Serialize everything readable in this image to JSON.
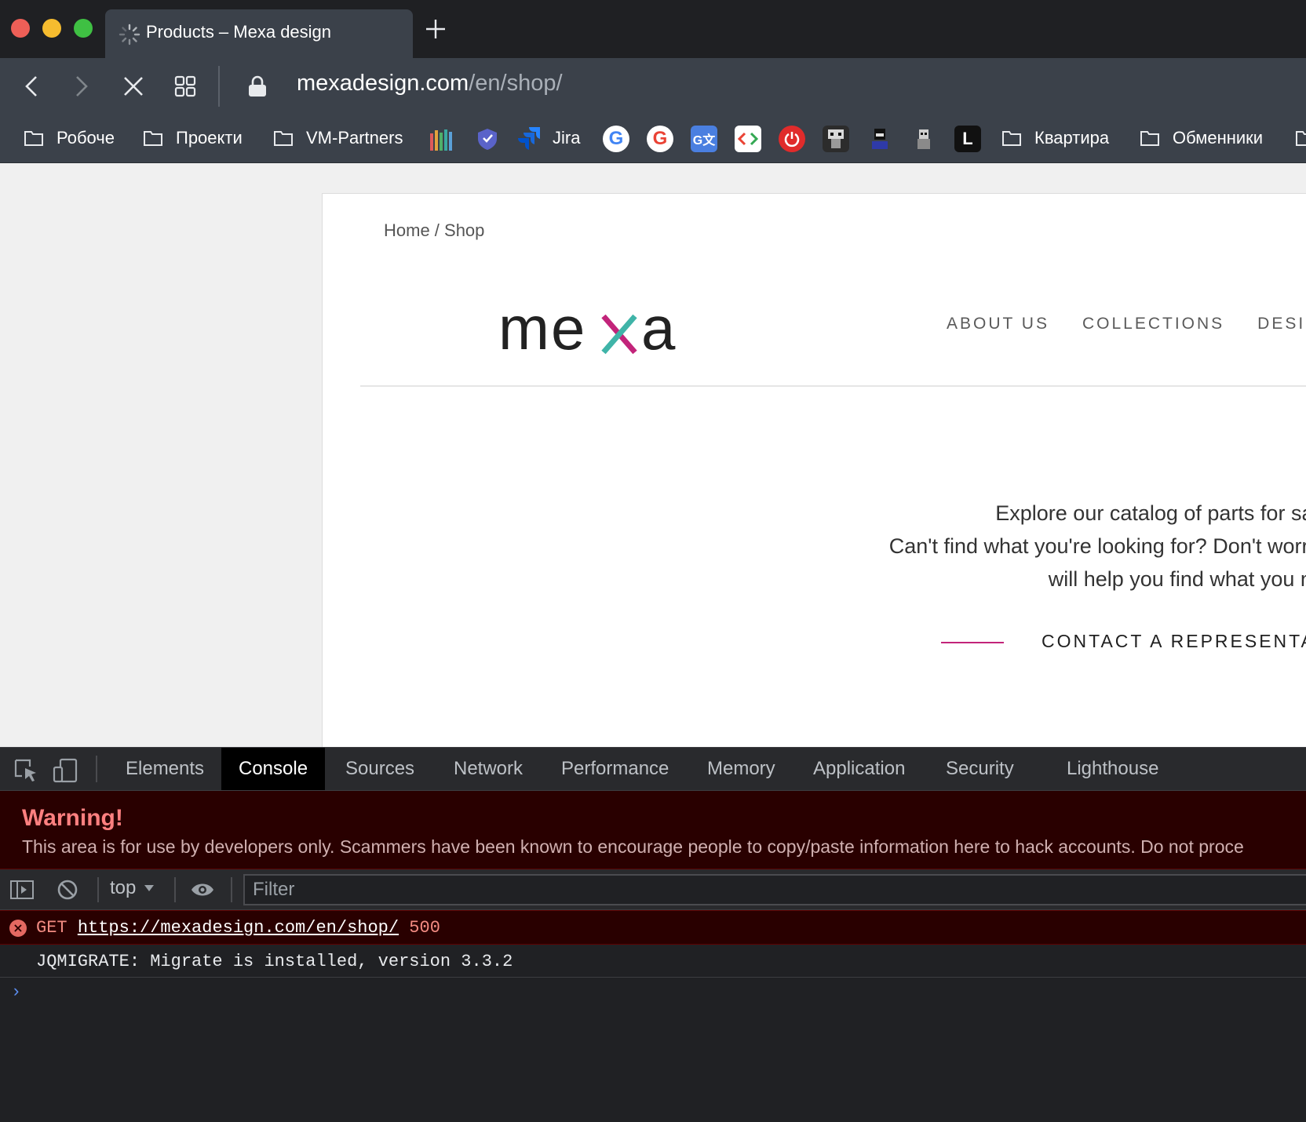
{
  "browser": {
    "tab_title": "Products – Mexa design",
    "url_host": "mexadesign.com",
    "url_path": "/en/shop/",
    "bookmarks": {
      "folder_1": "Робоче",
      "folder_2": "Проекти",
      "folder_3": "VM-Partners",
      "jira": "Jira",
      "folder_4": "Квартира",
      "folder_5": "Обменники"
    }
  },
  "page": {
    "breadcrumb": "Home / Shop",
    "logo_text": "mexa",
    "nav": [
      "ABOUT US",
      "COLLECTIONS",
      "DESIG"
    ],
    "hero_lines": [
      "Explore our catalog of parts for sale o",
      "Can't find what you're looking for? Don't worry! O",
      "will help you find what you need"
    ],
    "contact_cta": "CONTACT A REPRESENTA",
    "accent_color": "#c2247a"
  },
  "devtools": {
    "tabs": [
      "Elements",
      "Console",
      "Sources",
      "Network",
      "Performance",
      "Memory",
      "Application",
      "Security",
      "Lighthouse"
    ],
    "active_tab": "Console",
    "warning_title": "Warning!",
    "warning_body": "This area is for use by developers only. Scammers have been known to encourage people to copy/paste information here to hack accounts. Do not proce",
    "context": "top",
    "filter_placeholder": "Filter",
    "error": {
      "method": "GET",
      "url": "https://mexadesign.com/en/shop/",
      "status": "500"
    },
    "info": "JQMIGRATE: Migrate is installed, version 3.3.2",
    "prompt": "›"
  }
}
